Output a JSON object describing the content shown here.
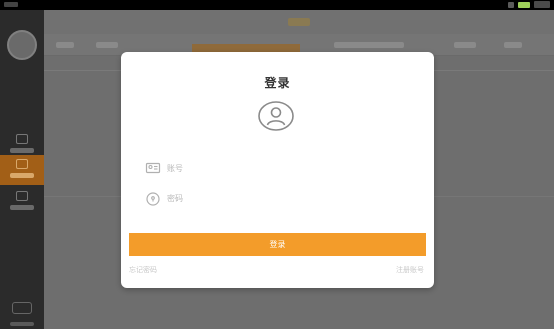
{
  "modal": {
    "title": "登录",
    "username_placeholder": "账号",
    "password_placeholder": "密码",
    "login_label": "登录",
    "forgot_label": "忘记密码",
    "register_label": "注册账号"
  },
  "sidebar": {
    "items": [
      {
        "label": "",
        "active": false
      },
      {
        "label": "",
        "active": true
      },
      {
        "label": "",
        "active": false
      }
    ]
  },
  "icons": {
    "avatar": "user-circle-icon",
    "username": "account-icon",
    "password": "lock-icon"
  },
  "colors": {
    "accent": "#f39c2a",
    "sidebar_bg": "#2b2b2b",
    "sidebar_active": "#a25f17",
    "overlay_bg": "#6f6f6f",
    "modal_bg": "#ffffff"
  }
}
